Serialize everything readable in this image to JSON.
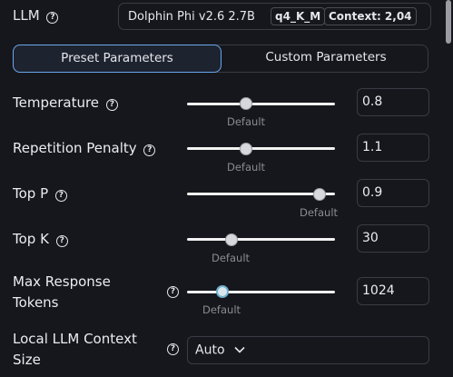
{
  "llm": {
    "label": "LLM",
    "model_name": "Dolphin Phi v2.6 2.7B",
    "quant": "q4_K_M",
    "context_badge": "Context: 2,04"
  },
  "tabs": {
    "preset": "Preset Parameters",
    "custom": "Custom Parameters",
    "active": "preset"
  },
  "params": [
    {
      "label": "Temperature",
      "value": "0.8",
      "default_label": "Default",
      "slider_fraction": 0.4
    },
    {
      "label": "Repetition Penalty",
      "value": "1.1",
      "default_label": "Default",
      "slider_fraction": 0.4
    },
    {
      "label": "Top P",
      "value": "0.9",
      "default_label": "Default",
      "slider_fraction": 0.9
    },
    {
      "label": "Top K",
      "value": "30",
      "default_label": "Default",
      "slider_fraction": 0.3
    },
    {
      "label_line1": "Max Response",
      "label_line2": "Tokens",
      "value": "1024",
      "default_label": "Default",
      "slider_fraction": 0.23
    }
  ],
  "context": {
    "label_line1": "Local LLM Context",
    "label_line2": "Size",
    "selected": "Auto"
  },
  "icons": {
    "help": "help-circle-icon",
    "dropdown": "chevron-down-icon"
  }
}
